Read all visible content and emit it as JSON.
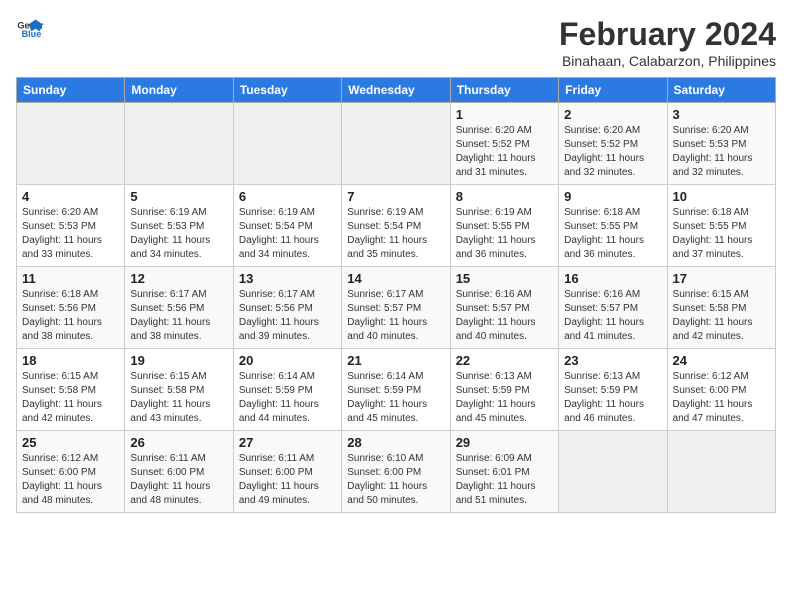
{
  "header": {
    "logo_line1": "General",
    "logo_line2": "Blue",
    "month_year": "February 2024",
    "location": "Binahaan, Calabarzon, Philippines"
  },
  "days_of_week": [
    "Sunday",
    "Monday",
    "Tuesday",
    "Wednesday",
    "Thursday",
    "Friday",
    "Saturday"
  ],
  "weeks": [
    [
      {
        "day": "",
        "empty": true
      },
      {
        "day": "",
        "empty": true
      },
      {
        "day": "",
        "empty": true
      },
      {
        "day": "",
        "empty": true
      },
      {
        "day": "1",
        "sunrise": "Sunrise: 6:20 AM",
        "sunset": "Sunset: 5:52 PM",
        "daylight": "Daylight: 11 hours and 31 minutes."
      },
      {
        "day": "2",
        "sunrise": "Sunrise: 6:20 AM",
        "sunset": "Sunset: 5:52 PM",
        "daylight": "Daylight: 11 hours and 32 minutes."
      },
      {
        "day": "3",
        "sunrise": "Sunrise: 6:20 AM",
        "sunset": "Sunset: 5:53 PM",
        "daylight": "Daylight: 11 hours and 32 minutes."
      }
    ],
    [
      {
        "day": "4",
        "sunrise": "Sunrise: 6:20 AM",
        "sunset": "Sunset: 5:53 PM",
        "daylight": "Daylight: 11 hours and 33 minutes."
      },
      {
        "day": "5",
        "sunrise": "Sunrise: 6:19 AM",
        "sunset": "Sunset: 5:53 PM",
        "daylight": "Daylight: 11 hours and 34 minutes."
      },
      {
        "day": "6",
        "sunrise": "Sunrise: 6:19 AM",
        "sunset": "Sunset: 5:54 PM",
        "daylight": "Daylight: 11 hours and 34 minutes."
      },
      {
        "day": "7",
        "sunrise": "Sunrise: 6:19 AM",
        "sunset": "Sunset: 5:54 PM",
        "daylight": "Daylight: 11 hours and 35 minutes."
      },
      {
        "day": "8",
        "sunrise": "Sunrise: 6:19 AM",
        "sunset": "Sunset: 5:55 PM",
        "daylight": "Daylight: 11 hours and 36 minutes."
      },
      {
        "day": "9",
        "sunrise": "Sunrise: 6:18 AM",
        "sunset": "Sunset: 5:55 PM",
        "daylight": "Daylight: 11 hours and 36 minutes."
      },
      {
        "day": "10",
        "sunrise": "Sunrise: 6:18 AM",
        "sunset": "Sunset: 5:55 PM",
        "daylight": "Daylight: 11 hours and 37 minutes."
      }
    ],
    [
      {
        "day": "11",
        "sunrise": "Sunrise: 6:18 AM",
        "sunset": "Sunset: 5:56 PM",
        "daylight": "Daylight: 11 hours and 38 minutes."
      },
      {
        "day": "12",
        "sunrise": "Sunrise: 6:17 AM",
        "sunset": "Sunset: 5:56 PM",
        "daylight": "Daylight: 11 hours and 38 minutes."
      },
      {
        "day": "13",
        "sunrise": "Sunrise: 6:17 AM",
        "sunset": "Sunset: 5:56 PM",
        "daylight": "Daylight: 11 hours and 39 minutes."
      },
      {
        "day": "14",
        "sunrise": "Sunrise: 6:17 AM",
        "sunset": "Sunset: 5:57 PM",
        "daylight": "Daylight: 11 hours and 40 minutes."
      },
      {
        "day": "15",
        "sunrise": "Sunrise: 6:16 AM",
        "sunset": "Sunset: 5:57 PM",
        "daylight": "Daylight: 11 hours and 40 minutes."
      },
      {
        "day": "16",
        "sunrise": "Sunrise: 6:16 AM",
        "sunset": "Sunset: 5:57 PM",
        "daylight": "Daylight: 11 hours and 41 minutes."
      },
      {
        "day": "17",
        "sunrise": "Sunrise: 6:15 AM",
        "sunset": "Sunset: 5:58 PM",
        "daylight": "Daylight: 11 hours and 42 minutes."
      }
    ],
    [
      {
        "day": "18",
        "sunrise": "Sunrise: 6:15 AM",
        "sunset": "Sunset: 5:58 PM",
        "daylight": "Daylight: 11 hours and 42 minutes."
      },
      {
        "day": "19",
        "sunrise": "Sunrise: 6:15 AM",
        "sunset": "Sunset: 5:58 PM",
        "daylight": "Daylight: 11 hours and 43 minutes."
      },
      {
        "day": "20",
        "sunrise": "Sunrise: 6:14 AM",
        "sunset": "Sunset: 5:59 PM",
        "daylight": "Daylight: 11 hours and 44 minutes."
      },
      {
        "day": "21",
        "sunrise": "Sunrise: 6:14 AM",
        "sunset": "Sunset: 5:59 PM",
        "daylight": "Daylight: 11 hours and 45 minutes."
      },
      {
        "day": "22",
        "sunrise": "Sunrise: 6:13 AM",
        "sunset": "Sunset: 5:59 PM",
        "daylight": "Daylight: 11 hours and 45 minutes."
      },
      {
        "day": "23",
        "sunrise": "Sunrise: 6:13 AM",
        "sunset": "Sunset: 5:59 PM",
        "daylight": "Daylight: 11 hours and 46 minutes."
      },
      {
        "day": "24",
        "sunrise": "Sunrise: 6:12 AM",
        "sunset": "Sunset: 6:00 PM",
        "daylight": "Daylight: 11 hours and 47 minutes."
      }
    ],
    [
      {
        "day": "25",
        "sunrise": "Sunrise: 6:12 AM",
        "sunset": "Sunset: 6:00 PM",
        "daylight": "Daylight: 11 hours and 48 minutes."
      },
      {
        "day": "26",
        "sunrise": "Sunrise: 6:11 AM",
        "sunset": "Sunset: 6:00 PM",
        "daylight": "Daylight: 11 hours and 48 minutes."
      },
      {
        "day": "27",
        "sunrise": "Sunrise: 6:11 AM",
        "sunset": "Sunset: 6:00 PM",
        "daylight": "Daylight: 11 hours and 49 minutes."
      },
      {
        "day": "28",
        "sunrise": "Sunrise: 6:10 AM",
        "sunset": "Sunset: 6:00 PM",
        "daylight": "Daylight: 11 hours and 50 minutes."
      },
      {
        "day": "29",
        "sunrise": "Sunrise: 6:09 AM",
        "sunset": "Sunset: 6:01 PM",
        "daylight": "Daylight: 11 hours and 51 minutes."
      },
      {
        "day": "",
        "empty": true
      },
      {
        "day": "",
        "empty": true
      }
    ]
  ]
}
